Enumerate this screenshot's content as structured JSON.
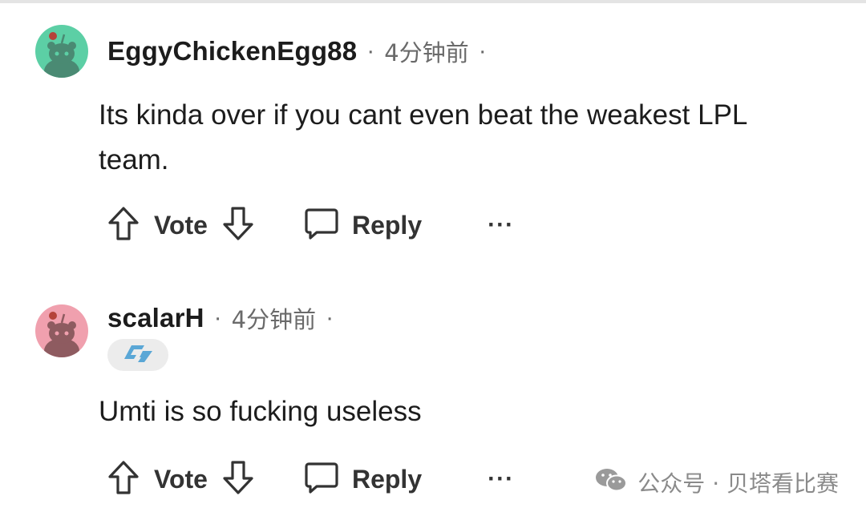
{
  "comments": [
    {
      "username": "EggyChickenEgg88",
      "timestamp": "4分钟前",
      "separator": "·",
      "avatar_color": "#5ccfa5",
      "body": "Its kinda over if you cant even beat the weakest LPL team.",
      "actions": {
        "vote_label": "Vote",
        "reply_label": "Reply",
        "more_label": "···"
      }
    },
    {
      "username": "scalarH",
      "timestamp": "4分钟前",
      "separator": "·",
      "avatar_color": "#f0a0ae",
      "flair_icon": "clg-logo-icon",
      "body": "Umti is so fucking useless",
      "actions": {
        "vote_label": "Vote",
        "reply_label": "Reply",
        "more_label": "···"
      }
    }
  ],
  "watermark": {
    "text": "公众号 · 贝塔看比赛",
    "icon": "wechat-icon"
  },
  "colors": {
    "text": "#1c1c1c",
    "meta": "#6a6a6a",
    "action": "#333333",
    "flair_bg": "#ececec",
    "flair_logo": "#5aa7d6"
  }
}
